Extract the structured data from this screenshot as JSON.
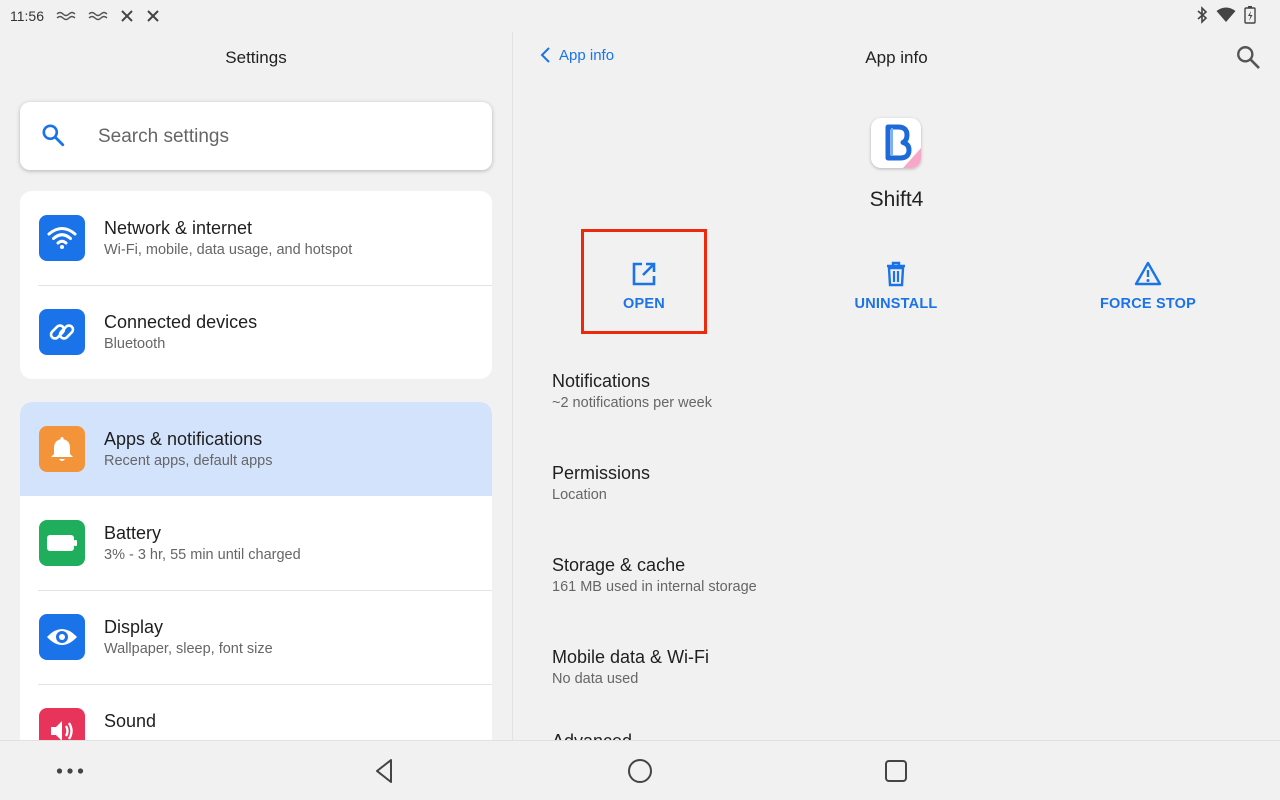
{
  "status_bar": {
    "time": "11:56",
    "notification_icons": [
      "wave-icon",
      "wave-icon",
      "signal-off-icon",
      "signal-off-icon"
    ],
    "right_icons": [
      "bluetooth-icon",
      "wifi-icon",
      "battery-charging-icon"
    ]
  },
  "left_pane": {
    "title": "Settings",
    "search_placeholder": "Search settings",
    "group1": [
      {
        "label": "Network & internet",
        "sub": "Wi-Fi, mobile, data usage, and hotspot",
        "icon": "wifi-icon",
        "color": "#1a73e8"
      },
      {
        "label": "Connected devices",
        "sub": "Bluetooth",
        "icon": "link-icon",
        "color": "#1a73e8"
      }
    ],
    "group2": [
      {
        "label": "Apps & notifications",
        "sub": "Recent apps, default apps",
        "icon": "bell-icon",
        "color": "#f4943a",
        "selected": true
      },
      {
        "label": "Battery",
        "sub": "3% - 3 hr, 55 min until charged",
        "icon": "battery-icon",
        "color": "#1fae5b"
      },
      {
        "label": "Display",
        "sub": "Wallpaper, sleep, font size",
        "icon": "eye-icon",
        "color": "#1a73e8"
      },
      {
        "label": "Sound",
        "sub": "",
        "icon": "speaker-icon",
        "color": "#e8335a"
      }
    ]
  },
  "right_pane": {
    "back_label": "App info",
    "title": "App info",
    "app_name": "Shift4",
    "actions": [
      {
        "label": "OPEN",
        "icon": "open-external-icon"
      },
      {
        "label": "UNINSTALL",
        "icon": "trash-icon"
      },
      {
        "label": "FORCE STOP",
        "icon": "warning-icon"
      }
    ],
    "prefs": [
      {
        "title": "Notifications",
        "summary": "~2 notifications per week"
      },
      {
        "title": "Permissions",
        "summary": "Location"
      },
      {
        "title": "Storage & cache",
        "summary": "161 MB used in internal storage"
      },
      {
        "title": "Mobile data & Wi-Fi",
        "summary": "No data used"
      },
      {
        "title": "Advanced",
        "summary": ""
      }
    ]
  },
  "nav_bar": {
    "buttons": [
      "more-icon",
      "back-icon",
      "home-icon",
      "recents-icon"
    ]
  },
  "colors": {
    "accent": "#1a73e8",
    "selected_bg": "#d4e3fc",
    "highlight": "#ee2a0c"
  }
}
